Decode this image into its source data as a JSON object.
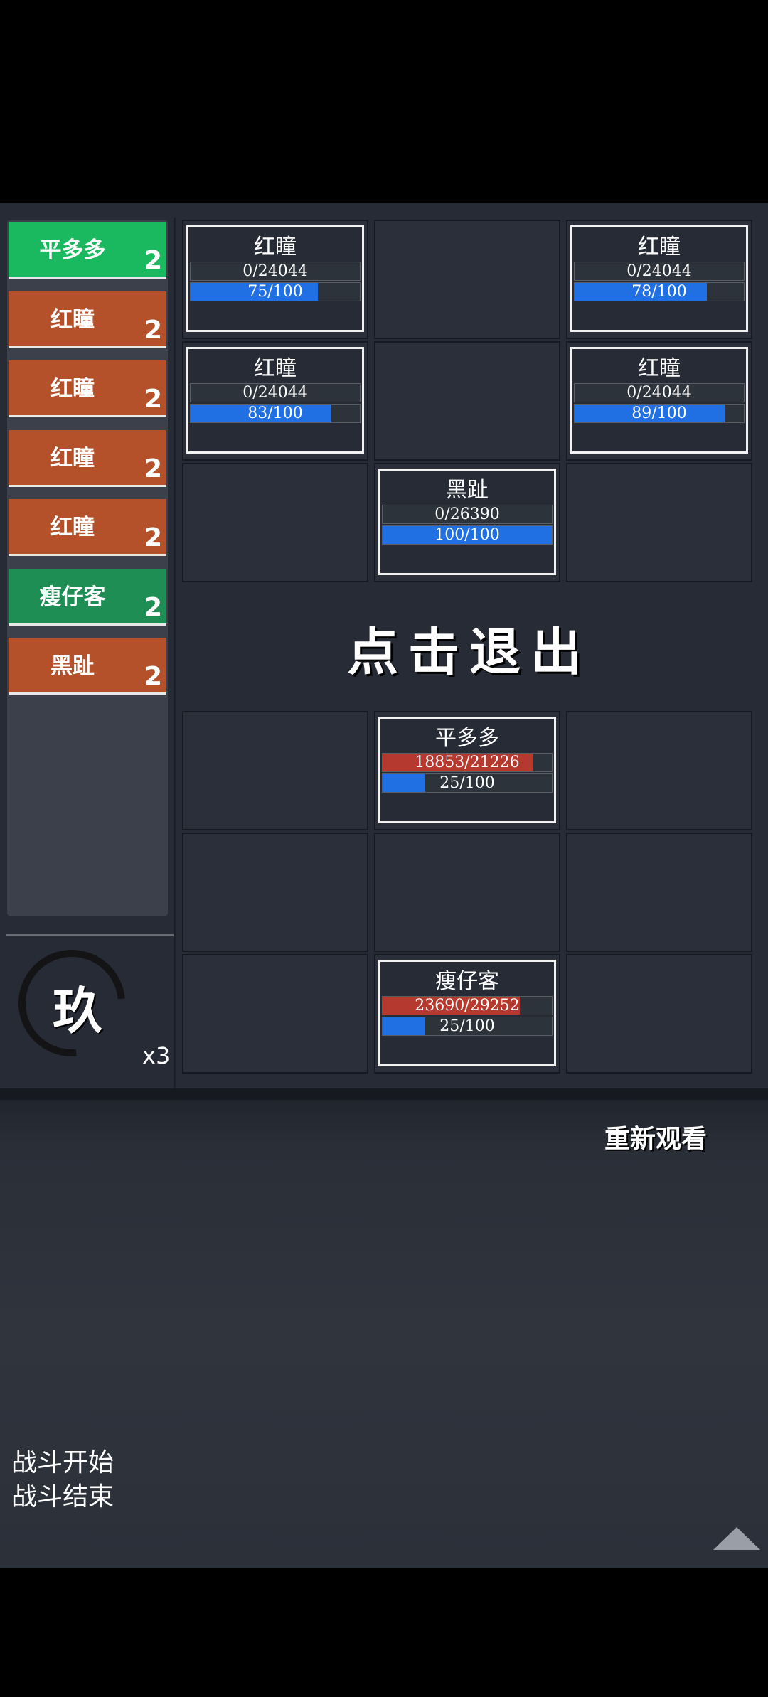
{
  "sidebar": {
    "items": [
      {
        "name": "平多多",
        "count": "2",
        "color": "#1ab85f"
      },
      {
        "name": "红瞳",
        "count": "2",
        "color": "#b5512a"
      },
      {
        "name": "红瞳",
        "count": "2",
        "color": "#b5512a"
      },
      {
        "name": "红瞳",
        "count": "2",
        "color": "#b5512a"
      },
      {
        "name": "红瞳",
        "count": "2",
        "color": "#b5512a"
      },
      {
        "name": "瘦仔客",
        "count": "2",
        "color": "#1f8e55"
      },
      {
        "name": "黑趾",
        "count": "2",
        "color": "#b5512a"
      }
    ],
    "speed_glyph": "玖",
    "speed_multiplier": "x3"
  },
  "enemy_units": [
    {
      "name": "红瞳",
      "hp_text": "0/24044",
      "hp_fraction": 0,
      "energy_text": "75/100",
      "energy_fraction": 0.75,
      "row": 0,
      "col": 0
    },
    {
      "name": "红瞳",
      "hp_text": "0/24044",
      "hp_fraction": 0,
      "energy_text": "78/100",
      "energy_fraction": 0.78,
      "row": 0,
      "col": 2
    },
    {
      "name": "红瞳",
      "hp_text": "0/24044",
      "hp_fraction": 0,
      "energy_text": "83/100",
      "energy_fraction": 0.83,
      "row": 1,
      "col": 0
    },
    {
      "name": "红瞳",
      "hp_text": "0/24044",
      "hp_fraction": 0,
      "energy_text": "89/100",
      "energy_fraction": 0.89,
      "row": 1,
      "col": 2
    },
    {
      "name": "黑趾",
      "hp_text": "0/26390",
      "hp_fraction": 0,
      "energy_text": "100/100",
      "energy_fraction": 1.0,
      "row": 2,
      "col": 1
    }
  ],
  "player_units": [
    {
      "name": "平多多",
      "hp_text": "18853/21226",
      "hp_fraction": 0.888,
      "energy_text": "25/100",
      "energy_fraction": 0.25,
      "row": 0,
      "col": 1
    },
    {
      "name": "瘦仔客",
      "hp_text": "23690/29252",
      "hp_fraction": 0.81,
      "energy_text": "25/100",
      "energy_fraction": 0.25,
      "row": 2,
      "col": 1
    }
  ],
  "exit_label": "点击退出",
  "replay_label": "重新观看",
  "battle_log": [
    "战斗开始",
    "战斗结束"
  ]
}
